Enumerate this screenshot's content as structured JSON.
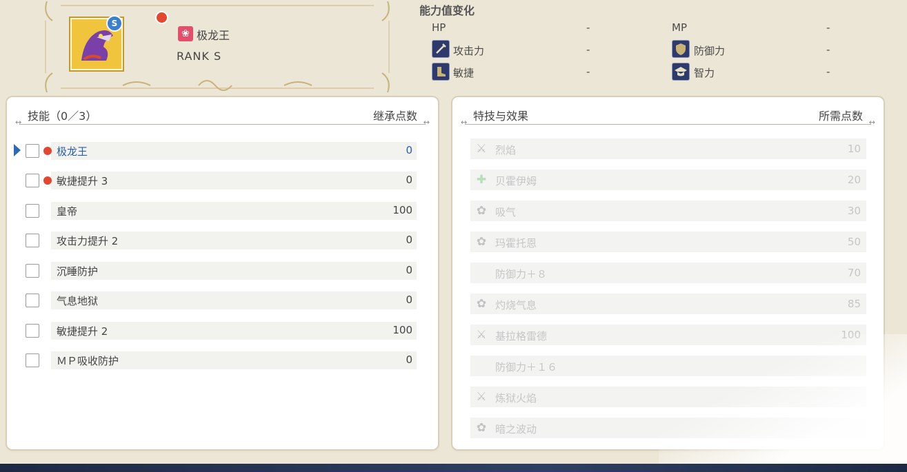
{
  "monster": {
    "rank_badge": "S",
    "family_icon": "dragon-family-icon",
    "name": "极龙王",
    "rank_label": "RANK  S"
  },
  "stats": {
    "title": "能力值变化",
    "items": [
      {
        "label": "HP",
        "value": "-",
        "icon": ""
      },
      {
        "label": "MP",
        "value": "-",
        "icon": ""
      },
      {
        "label": "攻击力",
        "value": "-",
        "icon": "sword-icon"
      },
      {
        "label": "防御力",
        "value": "-",
        "icon": "shield-icon"
      },
      {
        "label": "敏捷",
        "value": "-",
        "icon": "boot-icon"
      },
      {
        "label": "智力",
        "value": "-",
        "icon": "scholar-hat-icon"
      }
    ]
  },
  "skills_panel": {
    "title": "技能（0／3）",
    "points_header": "继承点数",
    "items": [
      {
        "name": "极龙王",
        "points": "0",
        "checked": false,
        "new": true,
        "selected": true
      },
      {
        "name": "敏捷提升 3",
        "points": "0",
        "checked": false,
        "new": true,
        "selected": false
      },
      {
        "name": "皇帝",
        "points": "100",
        "checked": false,
        "new": false,
        "selected": false
      },
      {
        "name": "攻击力提升 2",
        "points": "0",
        "checked": false,
        "new": false,
        "selected": false
      },
      {
        "name": "沉睡防护",
        "points": "0",
        "checked": false,
        "new": false,
        "selected": false
      },
      {
        "name": "气息地狱",
        "points": "0",
        "checked": false,
        "new": false,
        "selected": false
      },
      {
        "name": "敏捷提升 2",
        "points": "100",
        "checked": false,
        "new": false,
        "selected": false
      },
      {
        "name": "ＭＰ吸收防护",
        "points": "0",
        "checked": false,
        "new": false,
        "selected": false
      }
    ]
  },
  "effects_panel": {
    "title": "特技与效果",
    "points_header": "所需点数",
    "items": [
      {
        "name": "烈焰",
        "points": "10",
        "icon": "sword-icon"
      },
      {
        "name": "贝霍伊姆",
        "points": "20",
        "icon": "heal-cross-icon"
      },
      {
        "name": "吸气",
        "points": "30",
        "icon": "breath-icon"
      },
      {
        "name": "玛霍托恩",
        "points": "50",
        "icon": "breath-icon"
      },
      {
        "name": "防御力＋８",
        "points": "70",
        "icon": ""
      },
      {
        "name": "灼烧气息",
        "points": "85",
        "icon": "breath-icon"
      },
      {
        "name": "基拉格雷德",
        "points": "100",
        "icon": "sword-icon"
      },
      {
        "name": "防御力＋１６",
        "points": "",
        "icon": ""
      },
      {
        "name": "炼狱火焰",
        "points": "",
        "icon": "sword-icon"
      },
      {
        "name": "暗之波动",
        "points": "",
        "icon": "breath-icon"
      }
    ]
  }
}
